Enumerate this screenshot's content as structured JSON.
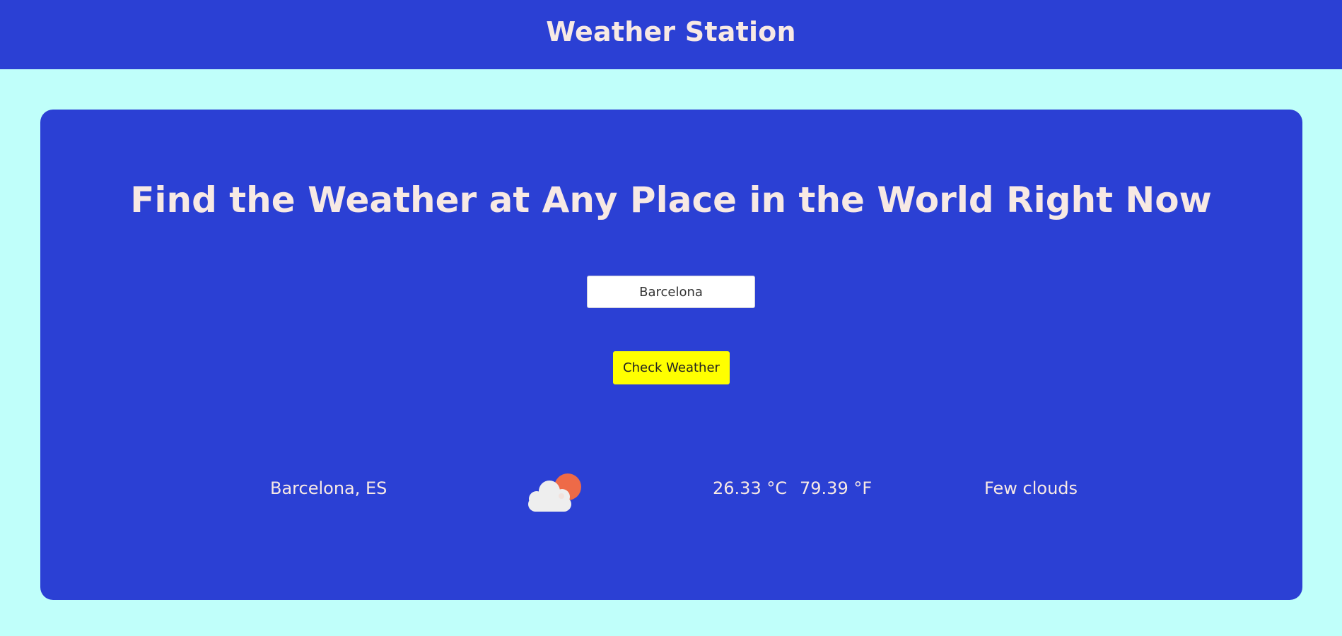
{
  "header": {
    "title": "Weather Station"
  },
  "main": {
    "headline": "Find the Weather at Any Place in the World Right Now",
    "search": {
      "value": "Barcelona",
      "placeholder": ""
    },
    "check_button_label": "Check Weather"
  },
  "result": {
    "location": "Barcelona, ES",
    "icon": "few-clouds-day-icon",
    "temp_c": "26.33 °C",
    "temp_f": "79.39 °F",
    "description": "Few clouds"
  },
  "colors": {
    "page_background": "#c0fffa",
    "primary": "#2b40d4",
    "text_light": "#f7e9e4",
    "button": "#ffff00",
    "sun": "#ee6a48",
    "cloud": "#eeeeee"
  }
}
